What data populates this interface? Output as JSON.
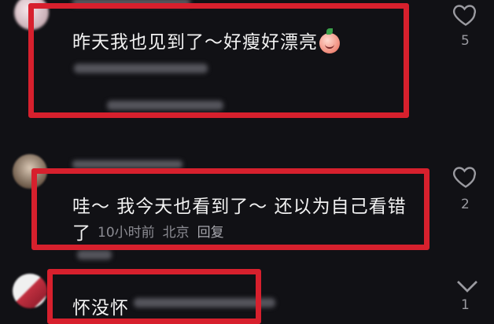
{
  "comments": [
    {
      "text": "昨天我也见到了～好瘦好漂亮",
      "emoji": "peach-face-emoji",
      "like_count": "5"
    },
    {
      "text_line1": "哇～ 我今天也看到了～ 还以为自己看错",
      "text_line2": "了",
      "time": "10小时前",
      "location": "北京",
      "reply": "回复",
      "like_count": "2"
    },
    {
      "text": "怀没怀",
      "like_count": "1"
    }
  ],
  "colors": {
    "background": "#111115",
    "highlight_frame": "#d7202d",
    "meta_text": "#8b8b92"
  }
}
